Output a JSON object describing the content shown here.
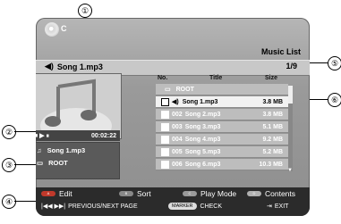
{
  "app": {
    "title": "Music List",
    "disc_icon": "disc-icon",
    "disc_text": "C"
  },
  "playing_bar": {
    "now_playing": "Song 1.mp3",
    "page_indicator": "1/9"
  },
  "player": {
    "controls": "■ ▶ ⏸",
    "time": "00:02:22",
    "current_song": "Song 1.mp3",
    "current_folder": "ROOT"
  },
  "list": {
    "headers": {
      "no": "No.",
      "title": "Title",
      "size": "Size"
    },
    "folder": {
      "label": "ROOT"
    },
    "items": [
      {
        "no": "",
        "title": "Song 1.mp3",
        "size": "3.8 MB",
        "selected": true
      },
      {
        "no": "002",
        "title": "Song 2.mp3",
        "size": "3.8 MB",
        "selected": false
      },
      {
        "no": "003",
        "title": "Song 3.mp3",
        "size": "5.1 MB",
        "selected": false
      },
      {
        "no": "004",
        "title": "Song 4.mp3",
        "size": "9.2 MB",
        "selected": false
      },
      {
        "no": "005",
        "title": "Song 5.mp3",
        "size": "5.2 MB",
        "selected": false
      },
      {
        "no": "006",
        "title": "Song 6.mp3",
        "size": "10.3 MB",
        "selected": false
      }
    ]
  },
  "bottom_bar": {
    "a_label": "A",
    "edit": "Edit",
    "b_label": "B",
    "sort": "Sort",
    "c_label": "C",
    "play_mode": "Play Mode",
    "d_label": "D",
    "contents": "Contents",
    "prev_next": "PREVIOUS/NEXT PAGE",
    "marker_label": "MARKER",
    "check": "CHECK",
    "exit": "EXIT"
  },
  "callouts": [
    "①",
    "②",
    "③",
    "④",
    "⑤",
    "⑥"
  ],
  "colors": {
    "a_button": "#c0392b",
    "b_button": "#888888",
    "c_button": "#9a9a9a",
    "d_button": "#b0b0b0"
  }
}
